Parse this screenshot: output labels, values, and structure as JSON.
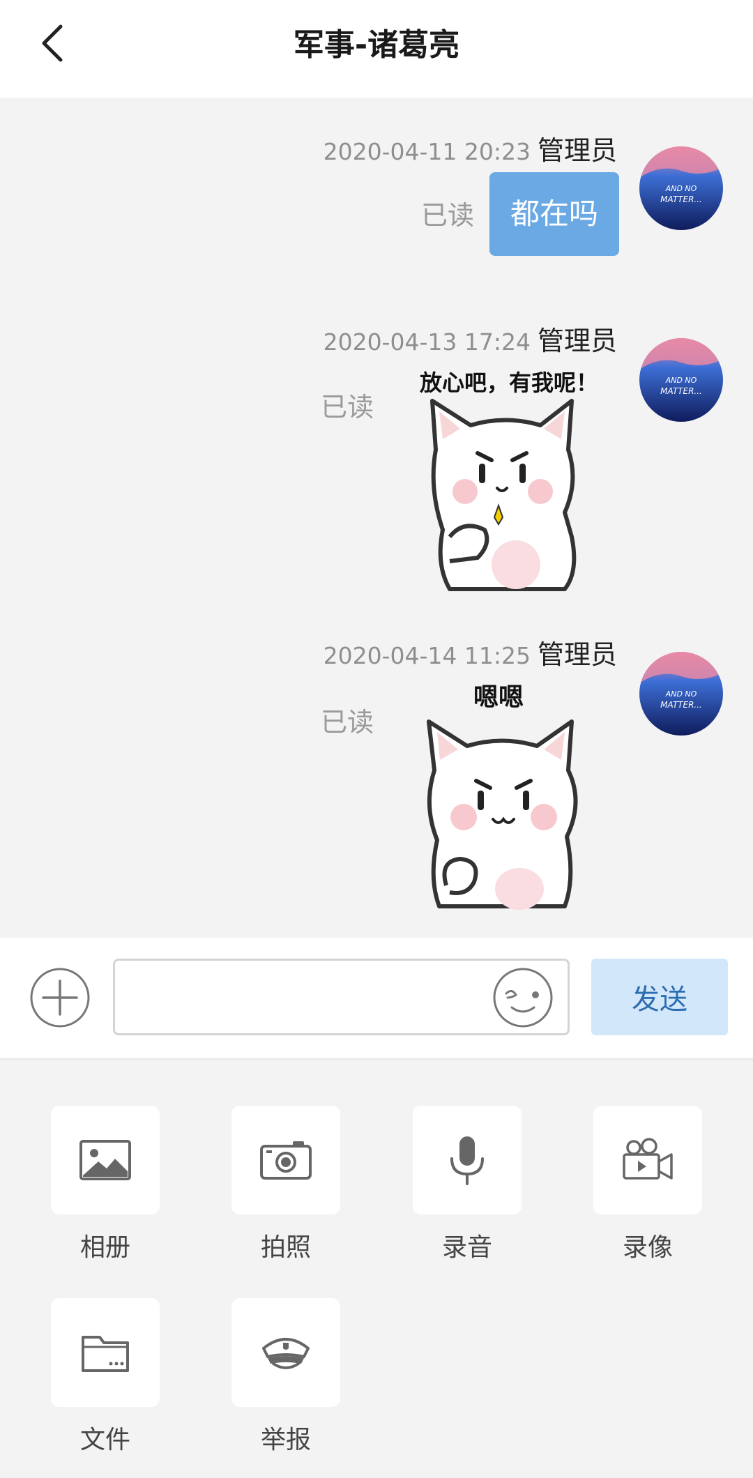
{
  "header": {
    "title": "军事-诸葛亮"
  },
  "messages": [
    {
      "time": "2020-04-11 20:23",
      "sender": "管理员",
      "status": "已读",
      "text": "都在吗",
      "type": "text"
    },
    {
      "time": "2020-04-13 17:24",
      "sender": "管理员",
      "status": "已读",
      "sticker_caption": "放心吧，有我呢！",
      "type": "sticker"
    },
    {
      "time": "2020-04-14 11:25",
      "sender": "管理员",
      "status": "已读",
      "sticker_caption": "嗯嗯",
      "type": "sticker"
    }
  ],
  "avatar": {
    "text_line1": "AND NO",
    "text_line2": "MATTER..."
  },
  "input": {
    "value": "",
    "placeholder": ""
  },
  "send_label": "发送",
  "tools": [
    {
      "label": "相册",
      "icon": "image-icon"
    },
    {
      "label": "拍照",
      "icon": "camera-icon"
    },
    {
      "label": "录音",
      "icon": "microphone-icon"
    },
    {
      "label": "录像",
      "icon": "video-camera-icon"
    },
    {
      "label": "文件",
      "icon": "folder-icon"
    },
    {
      "label": "举报",
      "icon": "police-cap-icon"
    }
  ],
  "colors": {
    "bubble": "#6aa9e4",
    "send_bg": "#d3e7fb",
    "send_text": "#2c6db2",
    "background": "#f3f3f3"
  }
}
